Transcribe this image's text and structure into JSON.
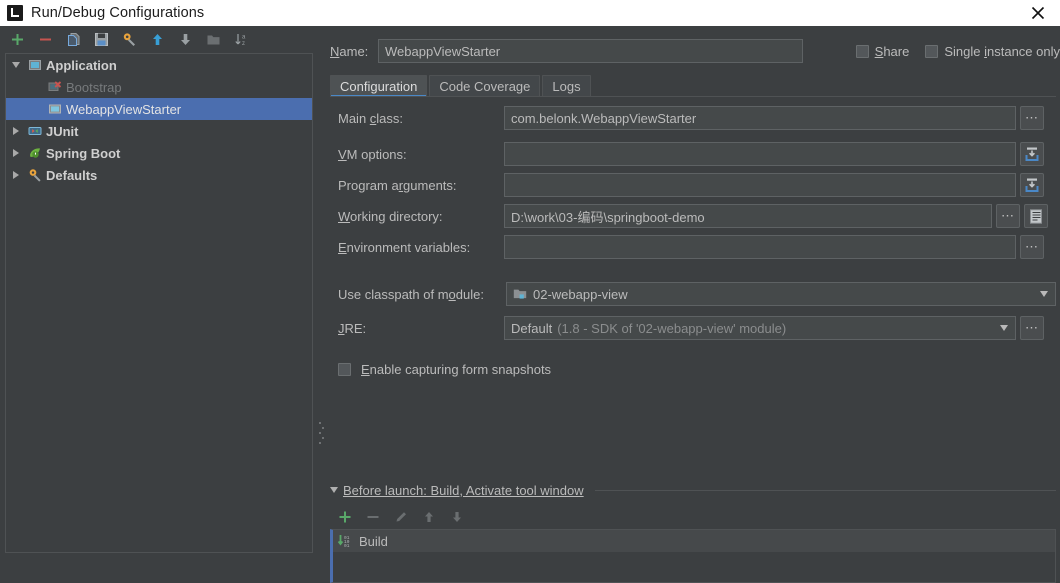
{
  "window": {
    "title": "Run/Debug Configurations",
    "app_icon": "intellij-idea-icon",
    "close_label": "✕"
  },
  "left_toolbar": {
    "items": [
      {
        "name": "add-configuration-button",
        "icon": "plus-icon",
        "tooltip": "Add New Configuration"
      },
      {
        "name": "remove-configuration-button",
        "icon": "minus-icon",
        "tooltip": "Remove Configuration"
      },
      {
        "name": "copy-configuration-button",
        "icon": "copy-icon",
        "tooltip": "Copy Configuration"
      },
      {
        "name": "save-configuration-button",
        "icon": "save-icon",
        "tooltip": "Save Configuration"
      },
      {
        "name": "edit-defaults-button",
        "icon": "wrench-gear-icon",
        "tooltip": "Edit defaults"
      },
      {
        "name": "move-up-button",
        "icon": "arrow-up-icon",
        "tooltip": "Move Up"
      },
      {
        "name": "move-down-button",
        "icon": "arrow-down-icon",
        "tooltip": "Move Down"
      },
      {
        "name": "create-folder-button",
        "icon": "folder-icon",
        "tooltip": "Create New Folder"
      },
      {
        "name": "sort-configurations-button",
        "icon": "sort-alpha-icon",
        "tooltip": "Sort Configurations"
      }
    ]
  },
  "tree": {
    "nodes": [
      {
        "label": "Application",
        "icon": "application-icon",
        "expander": "down",
        "level": 0,
        "style": "bold",
        "selected": false
      },
      {
        "label": "Bootstrap",
        "icon": "application-error-icon",
        "expander": "none",
        "level": 1,
        "style": "disabled",
        "selected": false
      },
      {
        "label": "WebappViewStarter",
        "icon": "application-icon",
        "expander": "none",
        "level": 1,
        "style": "normal",
        "selected": true
      },
      {
        "label": "JUnit",
        "icon": "junit-icon",
        "expander": "right",
        "level": 0,
        "style": "bold",
        "selected": false
      },
      {
        "label": "Spring Boot",
        "icon": "spring-boot-icon",
        "expander": "right",
        "level": 0,
        "style": "bold",
        "selected": false
      },
      {
        "label": "Defaults",
        "icon": "wrench-gear-icon",
        "expander": "right",
        "level": 0,
        "style": "bold",
        "selected": false
      }
    ]
  },
  "name_field": {
    "label": "Name:",
    "label_mnemonic": "N",
    "value": "WebappViewStarter"
  },
  "options": {
    "share": {
      "label": "Share",
      "mnemonic": "S",
      "checked": false
    },
    "single_instance": {
      "label": "Single instance only",
      "mnemonic": "i",
      "checked": false
    }
  },
  "tabs": [
    {
      "label": "Configuration",
      "active": true
    },
    {
      "label": "Code Coverage",
      "active": false
    },
    {
      "label": "Logs",
      "active": false
    }
  ],
  "form": {
    "main_class": {
      "label": "Main class:",
      "value": "com.belonk.WebappViewStarter",
      "button": "browse-dots"
    },
    "vm_options": {
      "label": "VM options:",
      "value": "",
      "button": "expand-editor"
    },
    "program_arguments": {
      "label": "Program arguments:",
      "value": "",
      "button": "expand-editor"
    },
    "working_directory": {
      "label": "Working directory:",
      "value": "D:\\work\\03-编码\\springboot-demo",
      "button": "browse-dots",
      "button2": "macros"
    },
    "environment_variables": {
      "label": "Environment variables:",
      "value": "",
      "button": "browse-dots"
    },
    "classpath_module": {
      "label": "Use classpath of module:",
      "value": "02-webapp-view",
      "icon": "module-icon"
    },
    "jre": {
      "label": "JRE:",
      "value": "Default",
      "value_hint": "(1.8 - SDK of '02-webapp-view' module)",
      "button": "browse-dots"
    },
    "form_snapshots": {
      "label": "Enable capturing form snapshots",
      "checked": false
    }
  },
  "before_launch": {
    "title": "Before launch: Build, Activate tool window",
    "expanded": true,
    "toolbar": [
      {
        "name": "add-task-button",
        "icon": "plus-icon",
        "enabled": true
      },
      {
        "name": "remove-task-button",
        "icon": "minus-icon",
        "enabled": false
      },
      {
        "name": "edit-task-button",
        "icon": "pencil-icon",
        "enabled": false
      },
      {
        "name": "move-task-up-button",
        "icon": "arrow-up-icon",
        "enabled": false
      },
      {
        "name": "move-task-down-button",
        "icon": "arrow-down-icon",
        "enabled": false
      }
    ],
    "tasks": [
      {
        "label": "Build",
        "icon": "compile-icon"
      }
    ]
  },
  "colors": {
    "dialog_bg": "#3c3f41",
    "titlebar_bg": "#ffffff",
    "field_bg": "#45494a",
    "selection_blue": "#4b6eaf",
    "accent_blue": "#4a88c7",
    "text": "#bbbbbb",
    "green": "#59a869",
    "red": "#c75450"
  }
}
